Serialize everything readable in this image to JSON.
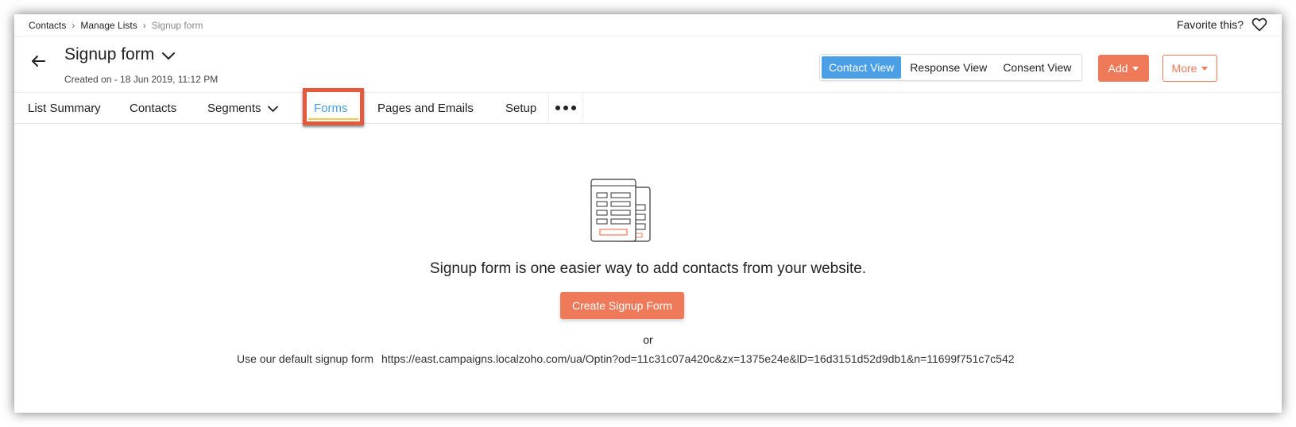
{
  "breadcrumb": {
    "items": [
      "Contacts",
      "Manage Lists",
      "Signup form"
    ]
  },
  "favorite": {
    "label": "Favorite this?",
    "icon": "heart-icon"
  },
  "header": {
    "title": "Signup form",
    "created": "Created on - 18 Jun 2019, 11:12 PM"
  },
  "views": {
    "contact": "Contact View",
    "response": "Response View",
    "consent": "Consent View",
    "active": "Contact View"
  },
  "actions": {
    "add": "Add",
    "more": "More"
  },
  "tabs": {
    "list_summary": "List Summary",
    "contacts": "Contacts",
    "segments": "Segments",
    "forms": "Forms",
    "pages_emails": "Pages and Emails",
    "setup": "Setup",
    "active": "Forms"
  },
  "empty_state": {
    "message": "Signup form is one easier way to add contacts from your website.",
    "button": "Create Signup Form",
    "or": "or",
    "default_label": "Use our default signup form",
    "default_url": "https://east.campaigns.localzoho.com/ua/Optin?od=11c31c07a420c&zx=1375e24e&lD=16d3151d52d9db1&n=11699f751c7c542"
  },
  "colors": {
    "accent_blue": "#4a9fe6",
    "accent_orange": "#ee7a59",
    "highlight_red": "#e45a3f"
  }
}
